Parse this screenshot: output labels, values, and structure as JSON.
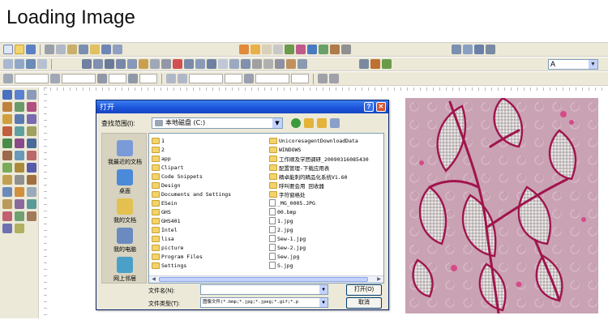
{
  "heading": "Loading Image",
  "toolbar": {
    "font_select_value": "A"
  },
  "dialog": {
    "title": "打开",
    "help_glyph": "?",
    "close_glyph": "✕",
    "look_in_label": "查找范围(I):",
    "look_in_value": "本地磁盘 (C:)",
    "places": [
      {
        "label": "我最近的文档"
      },
      {
        "label": "桌面"
      },
      {
        "label": "我的文档"
      },
      {
        "label": "我的电脑"
      },
      {
        "label": "网上邻居"
      }
    ],
    "files_col_a": [
      {
        "name": "1",
        "kind": "folder"
      },
      {
        "name": "2",
        "kind": "folder"
      },
      {
        "name": "app",
        "kind": "folder"
      },
      {
        "name": "Clipart",
        "kind": "folder"
      },
      {
        "name": "Code Snippets",
        "kind": "folder"
      },
      {
        "name": "Design",
        "kind": "folder"
      },
      {
        "name": "Documents and Settings",
        "kind": "folder"
      },
      {
        "name": "ESein",
        "kind": "folder"
      },
      {
        "name": "GHS",
        "kind": "folder"
      },
      {
        "name": "GHS401",
        "kind": "folder"
      },
      {
        "name": "Intel",
        "kind": "folder"
      },
      {
        "name": "lisa",
        "kind": "folder"
      },
      {
        "name": "picture",
        "kind": "folder"
      },
      {
        "name": "Program Files",
        "kind": "folder"
      },
      {
        "name": "Settings",
        "kind": "folder"
      }
    ],
    "files_col_b": [
      {
        "name": "UnicoresagentDownloadData",
        "kind": "folder"
      },
      {
        "name": "WINDOWS",
        "kind": "folder"
      },
      {
        "name": "工作顺及学团调研_20090316085430",
        "kind": "folder"
      },
      {
        "name": "配置管理-下载应用表",
        "kind": "folder"
      },
      {
        "name": "精卓能刺的精品化系统V1.60",
        "kind": "folder"
      },
      {
        "name": "呼叫要会用 回收器",
        "kind": "folder"
      },
      {
        "name": "字符窗格处",
        "kind": "folder"
      },
      {
        "name": "_MG_0005.JPG",
        "kind": "file"
      },
      {
        "name": "00.bmp",
        "kind": "file"
      },
      {
        "name": "1.jpg",
        "kind": "file"
      },
      {
        "name": "2.jpg",
        "kind": "file"
      },
      {
        "name": "Sew-1.jpg",
        "kind": "file"
      },
      {
        "name": "Sew-2.jpg",
        "kind": "file"
      },
      {
        "name": "Sew.jpg",
        "kind": "file"
      },
      {
        "name": "S.jpg",
        "kind": "file"
      }
    ],
    "file_name_label": "文件名(N):",
    "file_name_value": "",
    "file_type_label": "文件类型(T):",
    "file_type_value": "图像文件(*.bmp;*.jpg;*.jpeg;*.gif;*.p",
    "open_button": "打开(O)",
    "cancel_button": "取消"
  },
  "colors": {
    "titlebar": "#1a52d9",
    "dialog_bg": "#ece9d8",
    "fabric": "#c9a2b3",
    "embroidery_pink": "#b0205a"
  },
  "icons": [
    "new-file-icon",
    "open-folder-icon",
    "save-icon",
    "cut-icon",
    "copy-icon",
    "paste-icon",
    "print-icon",
    "undo-icon",
    "redo-icon",
    "select-arrow-icon",
    "pencil-icon",
    "fill-icon",
    "zoom-icon"
  ]
}
